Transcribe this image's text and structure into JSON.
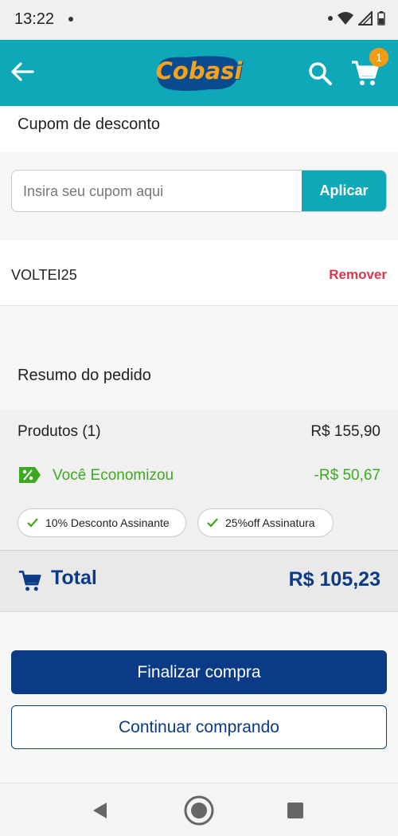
{
  "status_bar": {
    "time": "13:22"
  },
  "app_bar": {
    "logo_text": "Cobasi",
    "cart_count": "1"
  },
  "coupon": {
    "title": "Cupom de desconto",
    "placeholder": "Insira seu cupom aqui",
    "apply_label": "Aplicar",
    "applied_code": "VOLTEI25",
    "remove_label": "Remover"
  },
  "summary": {
    "title": "Resumo do pedido",
    "products_label": "Produtos (1)",
    "products_value": "R$ 155,90",
    "savings_label": "Você Economizou",
    "savings_value": "-R$ 50,67",
    "chips": [
      "10% Desconto Assinante",
      "25%off Assinatura"
    ],
    "total_label": "Total",
    "total_value": "R$ 105,23"
  },
  "actions": {
    "checkout_label": "Finalizar compra",
    "continue_label": "Continuar comprando"
  },
  "colors": {
    "brand_teal": "#0fa8b8",
    "brand_navy": "#0b3a86",
    "savings_green": "#3caa1f",
    "remove_red": "#d6394c",
    "badge_orange": "#f39c12",
    "logo_orange": "#f7a21b"
  },
  "icons": [
    "back-arrow-icon",
    "search-icon",
    "cart-icon",
    "discount-tag-icon",
    "check-icon",
    "nav-back-icon",
    "nav-home-icon",
    "nav-recent-icon"
  ]
}
